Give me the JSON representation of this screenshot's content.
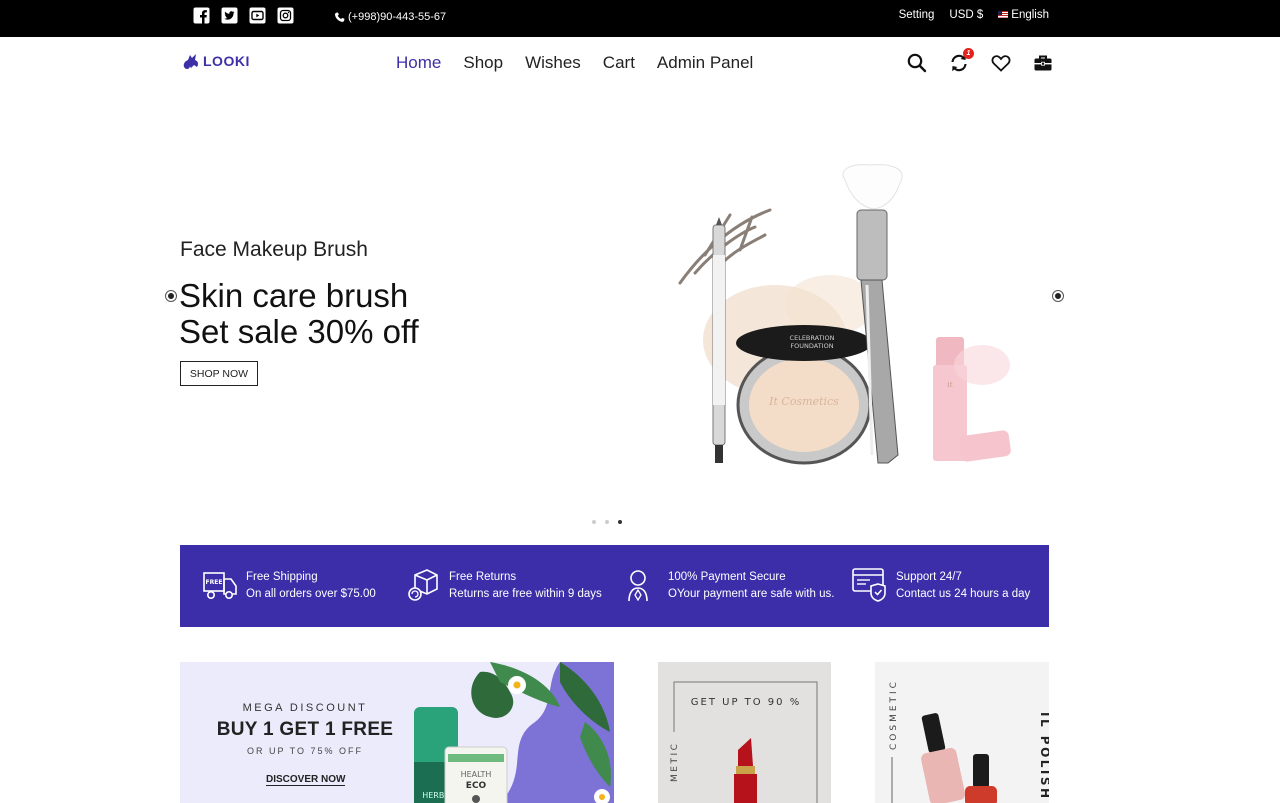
{
  "topbar": {
    "phone": "(+998)90-443-55-67",
    "setting": "Setting",
    "currency": "USD $",
    "language": "English",
    "social_icons": [
      "facebook-icon",
      "twitter-icon",
      "youtube-icon",
      "instagram-icon"
    ]
  },
  "header": {
    "logo": "LOOKI",
    "nav": [
      "Home",
      "Shop",
      "Wishes",
      "Cart",
      "Admin Panel"
    ],
    "active_nav": "Home",
    "compare_badge": "1"
  },
  "hero": {
    "subtitle": "Face Makeup Brush",
    "title_line1": "Skin care brush",
    "title_line2": "Set sale 30% off",
    "cta": "SHOP NOW",
    "slides": 3,
    "active_slide": 3
  },
  "features": [
    {
      "title": "Free Shipping",
      "desc": "On all orders over $75.00",
      "icon": "truck-icon"
    },
    {
      "title": "Free Returns",
      "desc": "Returns are free within 9 days",
      "icon": "return-box-icon"
    },
    {
      "title": "100% Payment Secure",
      "desc": "OYour payment are safe with us.",
      "icon": "secure-payment-icon"
    },
    {
      "title": "Support 24/7",
      "desc": "Contact us 24 hours a day",
      "icon": "support-icon"
    }
  ],
  "banners": {
    "b1": {
      "small": "MEGA DISCOUNT",
      "big": "BUY 1 GET 1 FREE",
      "small2": "OR UP TO 75% OFF",
      "link": "DISCOVER NOW",
      "tube1": "HERBA BEAUTY",
      "tube2": "HEALTH ECO"
    },
    "b2": {
      "text": "GET UP TO 90 %",
      "side": "METIC"
    },
    "b3": {
      "side": "COSMETIC",
      "vertical": "IL POLISH"
    }
  },
  "colors": {
    "accent": "#3b2ea8",
    "topbar": "#000000"
  }
}
